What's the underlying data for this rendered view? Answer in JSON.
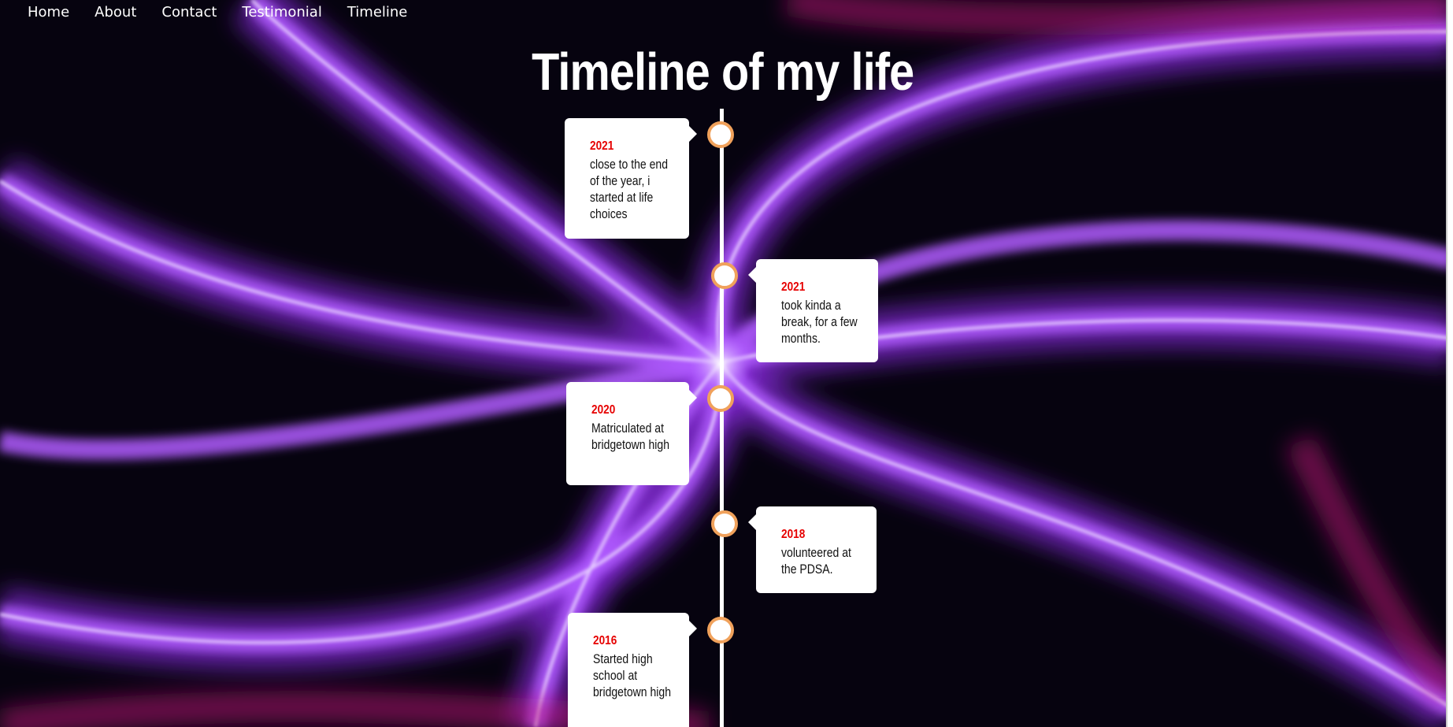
{
  "nav": {
    "items": [
      "Home",
      "About",
      "Contact",
      "Testimonial",
      "Timeline"
    ]
  },
  "page": {
    "title": "Timeline of my life"
  },
  "colors": {
    "year_text": "#e60000",
    "dot_border": "#f0a15b",
    "card_bg": "#ffffff",
    "background_accent": "#9b3df5"
  },
  "timeline": {
    "events": [
      {
        "year": "2021",
        "text": "close to the end of the year, i started at life choices",
        "side": "left"
      },
      {
        "year": "2021",
        "text": "took kinda a break, for a few months.",
        "side": "right"
      },
      {
        "year": "2020",
        "text": "Matriculated at bridgetown high",
        "side": "left"
      },
      {
        "year": "2018",
        "text": "volunteered at the PDSA.",
        "side": "right"
      },
      {
        "year": "2016",
        "text": "Started high school at bridgetown high",
        "side": "left"
      }
    ]
  }
}
